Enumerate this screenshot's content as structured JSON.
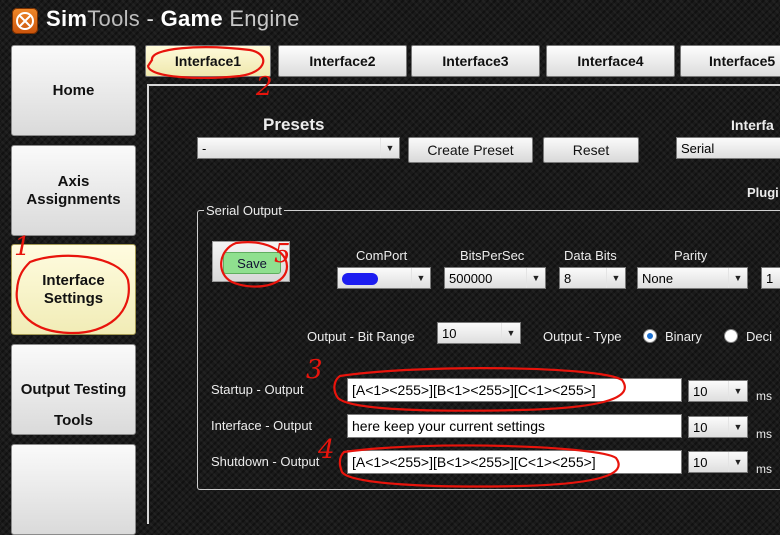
{
  "window": {
    "title_sim": "Sim",
    "title_tools": "Tools",
    "title_dash": " - ",
    "title_game": "Game",
    "title_engine": " Engine"
  },
  "sidebar": {
    "items": [
      {
        "label": "Home"
      },
      {
        "label": "Axis Assignments"
      },
      {
        "label": "Interface Settings"
      },
      {
        "label": "Output Testing"
      },
      {
        "label": "Tools"
      }
    ]
  },
  "tabs": [
    {
      "label": "Interface1"
    },
    {
      "label": "Interface2"
    },
    {
      "label": "Interface3"
    },
    {
      "label": "Interface4"
    },
    {
      "label": "Interface5"
    }
  ],
  "presets": {
    "heading": "Presets",
    "selected": "-",
    "create_label": "Create Preset",
    "reset_label": "Reset"
  },
  "interface": {
    "heading_partial": "Interfa",
    "type_selected": "Serial",
    "plugin_partial": "Plugi"
  },
  "serial_output": {
    "legend": "Serial Output",
    "save_label": "Save",
    "comport_label": "ComPort",
    "bitspersec_label": "BitsPerSec",
    "bitspersec_value": "500000",
    "databits_label": "Data Bits",
    "databits_value": "8",
    "parity_label": "Parity",
    "parity_value": "None",
    "stopbits_partial": "1",
    "bitrange_label": "Output - Bit Range",
    "bitrange_value": "10",
    "type_label": "Output - Type",
    "type_binary": "Binary",
    "type_decimal_partial": "Deci",
    "startup_label": "Startup - Output",
    "startup_value": "[A<1><255>][B<1><255>][C<1><255>]",
    "startup_ms": "10",
    "interface_label": "Interface - Output",
    "interface_value": "here keep your current settings",
    "interface_ms": "10",
    "shutdown_label": "Shutdown - Output",
    "shutdown_value": "[A<1><255>][B<1><255>][C<1><255>]",
    "shutdown_ms": "10",
    "ms_unit": "ms"
  },
  "annotations": {
    "n1": "1",
    "n2": "2",
    "n3": "3",
    "n4": "4",
    "n5": "5"
  },
  "colors": {
    "annotation_red": "#e8140c",
    "save_green": "#8fe08f",
    "radio_blue": "#1b6fd0"
  }
}
